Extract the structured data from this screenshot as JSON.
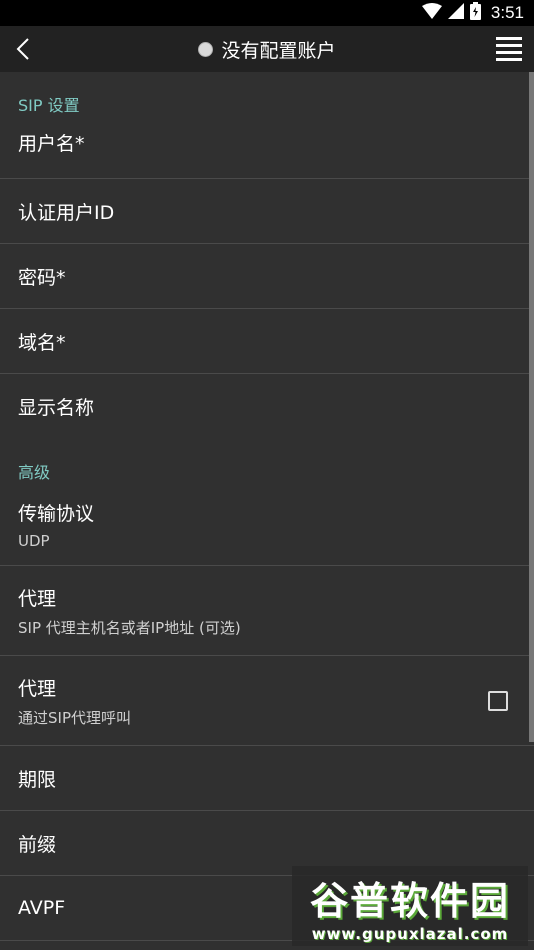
{
  "status_bar": {
    "time": "3:51"
  },
  "toolbar": {
    "title": "没有配置账户"
  },
  "sections": {
    "sip": {
      "header": "SIP 设置",
      "items": [
        {
          "label": "用户名*"
        },
        {
          "label": "认证用户ID"
        },
        {
          "label": "密码*"
        },
        {
          "label": "域名*"
        },
        {
          "label": "显示名称"
        }
      ]
    },
    "advanced": {
      "header": "高级",
      "items": [
        {
          "label": "传输协议",
          "summary": "UDP"
        },
        {
          "label": "代理",
          "summary": "SIP 代理主机名或者IP地址 (可选)"
        },
        {
          "label": "代理",
          "summary": "通过SIP代理呼叫",
          "checked": false
        },
        {
          "label": "期限"
        },
        {
          "label": "前缀"
        },
        {
          "label": "AVPF"
        }
      ]
    }
  },
  "watermark": {
    "title": "谷普软件园",
    "url": "www.gupuxlazal.com"
  },
  "colors": {
    "accent": "#80cbc4",
    "background": "#303030",
    "toolbar": "#222222"
  }
}
